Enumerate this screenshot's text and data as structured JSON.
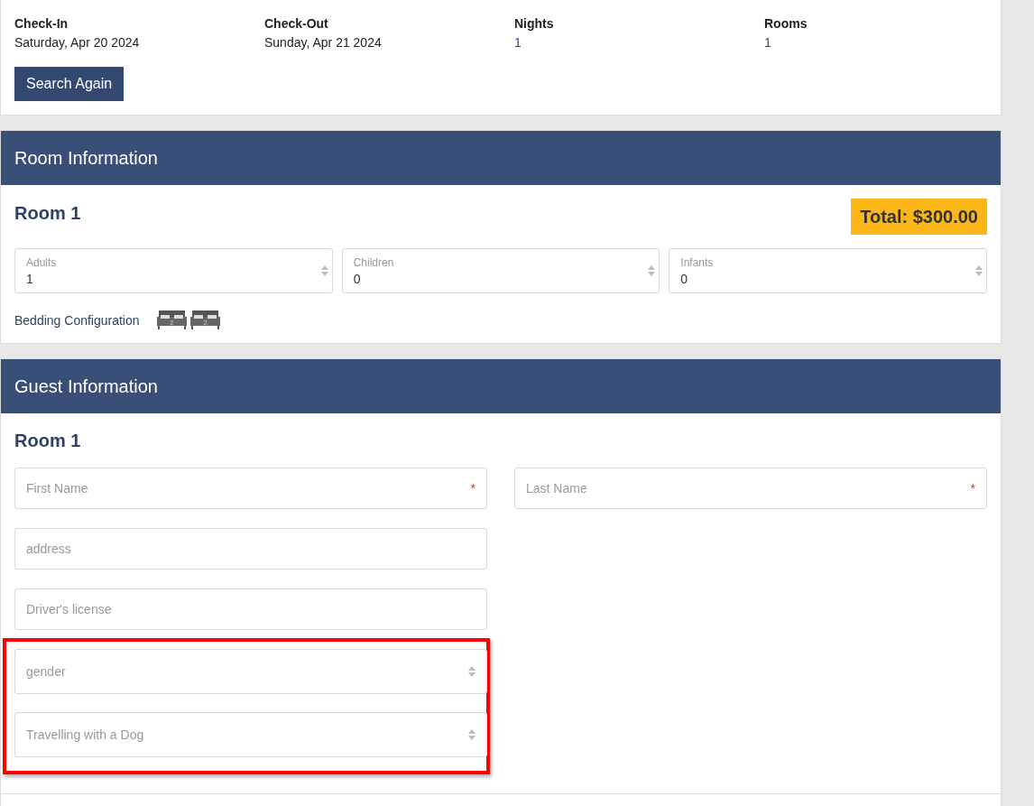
{
  "stay_summary": [
    {
      "label": "Check-In",
      "value": "Saturday, Apr 20 2024"
    },
    {
      "label": "Check-Out",
      "value": "Sunday, Apr 21 2024"
    },
    {
      "label": "Nights",
      "value": "1"
    },
    {
      "label": "Rooms",
      "value": "1"
    }
  ],
  "search_button": "Search Again",
  "room_information": {
    "title": "Room Information",
    "room_title": "Room 1",
    "total": "Total: $300.00",
    "occupancy": [
      {
        "label": "Adults",
        "value": "1"
      },
      {
        "label": "Children",
        "value": "0"
      },
      {
        "label": "Infants",
        "value": "0"
      }
    ],
    "bedding_label": "Bedding Configuration",
    "beds": [
      {
        "count": "2"
      },
      {
        "count": "2"
      }
    ]
  },
  "guest_information": {
    "title": "Guest Information",
    "room_title": "Room 1",
    "fields": [
      {
        "kind": "text",
        "placeholder": "First Name",
        "required_mark": "*"
      },
      {
        "kind": "text",
        "placeholder": "Last Name",
        "required_mark": "*"
      },
      {
        "kind": "text",
        "placeholder": "address"
      },
      {
        "kind": "text",
        "placeholder": "Driver's license"
      },
      {
        "kind": "select",
        "placeholder": "gender",
        "highlighted": true
      },
      {
        "kind": "select",
        "placeholder": "Travelling with a Dog",
        "highlighted": true
      }
    ]
  }
}
